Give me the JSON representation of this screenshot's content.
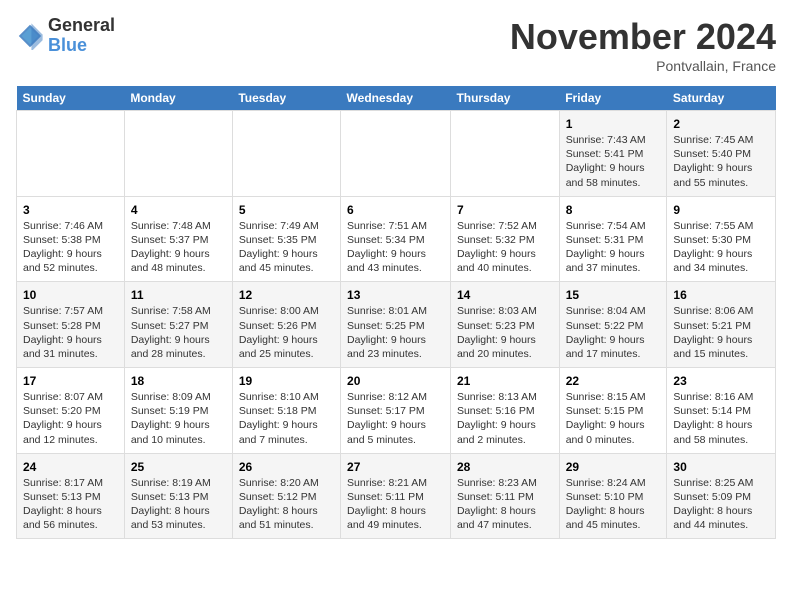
{
  "header": {
    "logo_general": "General",
    "logo_blue": "Blue",
    "month_title": "November 2024",
    "location": "Pontvallain, France"
  },
  "days_of_week": [
    "Sunday",
    "Monday",
    "Tuesday",
    "Wednesday",
    "Thursday",
    "Friday",
    "Saturday"
  ],
  "weeks": [
    [
      {
        "day": "",
        "info": ""
      },
      {
        "day": "",
        "info": ""
      },
      {
        "day": "",
        "info": ""
      },
      {
        "day": "",
        "info": ""
      },
      {
        "day": "",
        "info": ""
      },
      {
        "day": "1",
        "info": "Sunrise: 7:43 AM\nSunset: 5:41 PM\nDaylight: 9 hours and 58 minutes."
      },
      {
        "day": "2",
        "info": "Sunrise: 7:45 AM\nSunset: 5:40 PM\nDaylight: 9 hours and 55 minutes."
      }
    ],
    [
      {
        "day": "3",
        "info": "Sunrise: 7:46 AM\nSunset: 5:38 PM\nDaylight: 9 hours and 52 minutes."
      },
      {
        "day": "4",
        "info": "Sunrise: 7:48 AM\nSunset: 5:37 PM\nDaylight: 9 hours and 48 minutes."
      },
      {
        "day": "5",
        "info": "Sunrise: 7:49 AM\nSunset: 5:35 PM\nDaylight: 9 hours and 45 minutes."
      },
      {
        "day": "6",
        "info": "Sunrise: 7:51 AM\nSunset: 5:34 PM\nDaylight: 9 hours and 43 minutes."
      },
      {
        "day": "7",
        "info": "Sunrise: 7:52 AM\nSunset: 5:32 PM\nDaylight: 9 hours and 40 minutes."
      },
      {
        "day": "8",
        "info": "Sunrise: 7:54 AM\nSunset: 5:31 PM\nDaylight: 9 hours and 37 minutes."
      },
      {
        "day": "9",
        "info": "Sunrise: 7:55 AM\nSunset: 5:30 PM\nDaylight: 9 hours and 34 minutes."
      }
    ],
    [
      {
        "day": "10",
        "info": "Sunrise: 7:57 AM\nSunset: 5:28 PM\nDaylight: 9 hours and 31 minutes."
      },
      {
        "day": "11",
        "info": "Sunrise: 7:58 AM\nSunset: 5:27 PM\nDaylight: 9 hours and 28 minutes."
      },
      {
        "day": "12",
        "info": "Sunrise: 8:00 AM\nSunset: 5:26 PM\nDaylight: 9 hours and 25 minutes."
      },
      {
        "day": "13",
        "info": "Sunrise: 8:01 AM\nSunset: 5:25 PM\nDaylight: 9 hours and 23 minutes."
      },
      {
        "day": "14",
        "info": "Sunrise: 8:03 AM\nSunset: 5:23 PM\nDaylight: 9 hours and 20 minutes."
      },
      {
        "day": "15",
        "info": "Sunrise: 8:04 AM\nSunset: 5:22 PM\nDaylight: 9 hours and 17 minutes."
      },
      {
        "day": "16",
        "info": "Sunrise: 8:06 AM\nSunset: 5:21 PM\nDaylight: 9 hours and 15 minutes."
      }
    ],
    [
      {
        "day": "17",
        "info": "Sunrise: 8:07 AM\nSunset: 5:20 PM\nDaylight: 9 hours and 12 minutes."
      },
      {
        "day": "18",
        "info": "Sunrise: 8:09 AM\nSunset: 5:19 PM\nDaylight: 9 hours and 10 minutes."
      },
      {
        "day": "19",
        "info": "Sunrise: 8:10 AM\nSunset: 5:18 PM\nDaylight: 9 hours and 7 minutes."
      },
      {
        "day": "20",
        "info": "Sunrise: 8:12 AM\nSunset: 5:17 PM\nDaylight: 9 hours and 5 minutes."
      },
      {
        "day": "21",
        "info": "Sunrise: 8:13 AM\nSunset: 5:16 PM\nDaylight: 9 hours and 2 minutes."
      },
      {
        "day": "22",
        "info": "Sunrise: 8:15 AM\nSunset: 5:15 PM\nDaylight: 9 hours and 0 minutes."
      },
      {
        "day": "23",
        "info": "Sunrise: 8:16 AM\nSunset: 5:14 PM\nDaylight: 8 hours and 58 minutes."
      }
    ],
    [
      {
        "day": "24",
        "info": "Sunrise: 8:17 AM\nSunset: 5:13 PM\nDaylight: 8 hours and 56 minutes."
      },
      {
        "day": "25",
        "info": "Sunrise: 8:19 AM\nSunset: 5:13 PM\nDaylight: 8 hours and 53 minutes."
      },
      {
        "day": "26",
        "info": "Sunrise: 8:20 AM\nSunset: 5:12 PM\nDaylight: 8 hours and 51 minutes."
      },
      {
        "day": "27",
        "info": "Sunrise: 8:21 AM\nSunset: 5:11 PM\nDaylight: 8 hours and 49 minutes."
      },
      {
        "day": "28",
        "info": "Sunrise: 8:23 AM\nSunset: 5:11 PM\nDaylight: 8 hours and 47 minutes."
      },
      {
        "day": "29",
        "info": "Sunrise: 8:24 AM\nSunset: 5:10 PM\nDaylight: 8 hours and 45 minutes."
      },
      {
        "day": "30",
        "info": "Sunrise: 8:25 AM\nSunset: 5:09 PM\nDaylight: 8 hours and 44 minutes."
      }
    ]
  ]
}
